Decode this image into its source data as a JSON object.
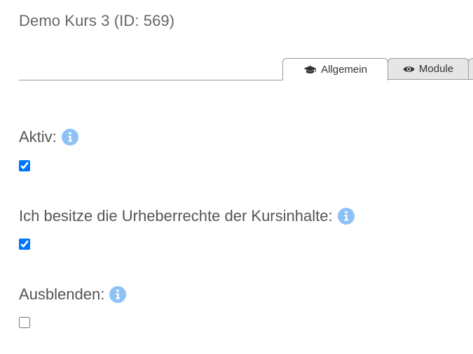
{
  "page": {
    "title": "Demo Kurs 3 (ID: 569)"
  },
  "tabs": [
    {
      "label": "Allgemein",
      "icon": "graduation-cap-icon",
      "active": true
    },
    {
      "label": "Module",
      "icon": "eye-icon",
      "active": false
    }
  ],
  "fields": [
    {
      "label": "Aktiv:",
      "checked": true,
      "info_icon": "info-icon"
    },
    {
      "label": "Ich besitze die Urheberrechte der Kursinhalte:",
      "checked": true,
      "info_icon": "info-icon"
    },
    {
      "label": "Ausblenden:",
      "checked": false,
      "info_icon": "info-icon"
    }
  ],
  "colors": {
    "info_icon": "#8ec1f5",
    "checkbox_accent": "#0075ff",
    "inactive_tab_bg": "#e6e6e6",
    "text": "#545454"
  }
}
